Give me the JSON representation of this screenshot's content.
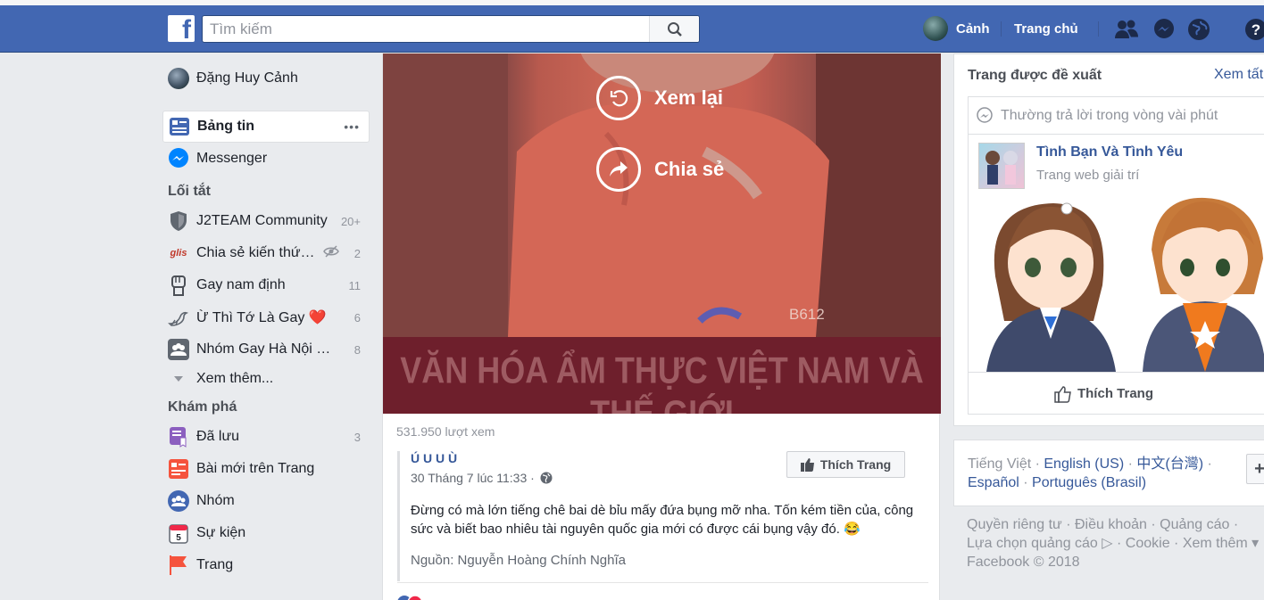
{
  "header": {
    "logo": "f",
    "search_placeholder": "Tìm kiếm",
    "user_name": "Cảnh",
    "home": "Trang chủ",
    "help": "?"
  },
  "nav": {
    "profile": "Đặng Huy Cảnh",
    "news_feed": "Bảng tin",
    "news_feed_more": "•••",
    "messenger": "Messenger",
    "shortcuts_title": "Lối tắt",
    "shortcuts": [
      {
        "label": "J2TEAM Community",
        "count": "20+"
      },
      {
        "label": "Chia sẻ kiến thứ…",
        "count": "2"
      },
      {
        "label": "Gay nam định",
        "count": "11"
      },
      {
        "label": "Ừ Thì Tớ Là Gay ❤️",
        "count": "6"
      },
      {
        "label": "Nhóm Gay Hà Nội …",
        "count": "8"
      }
    ],
    "shortcuts_more": "Xem thêm...",
    "explore_title": "Khám phá",
    "explore": [
      {
        "label": "Đã lưu",
        "count": "3"
      },
      {
        "label": "Bài mới trên Trang",
        "count": ""
      },
      {
        "label": "Nhóm",
        "count": ""
      },
      {
        "label": "Sự kiện",
        "count": ""
      },
      {
        "label": "Trang",
        "count": ""
      }
    ],
    "glis_icon_text": "glis"
  },
  "post": {
    "replay": "Xem lại",
    "share": "Chia sẻ",
    "banner": "VĂN HÓA ẨM THỰC VIỆT NAM VÀ THẾ GIỚI",
    "watermark": "B612",
    "views": "531.950 lượt xem",
    "page_name": "Ú U U Ù",
    "timestamp": "30 Tháng 7 lúc 11:33 ·",
    "like_page": "Thích Trang",
    "text": "Đừng có mà lớn tiếng chê bai dè bỉu mấy đứa bụng mỡ nha. Tốn kém tiền của, công sức và biết bao nhiêu tài nguyên quốc gia mới có được cái bụng vậy đó. 😂",
    "source": "Nguồn: Nguyễn Hoàng Chính Nghĩa"
  },
  "suggested": {
    "title": "Trang được đề xuất",
    "see_all": "Xem tất",
    "respond": "Thường trả lời trong vòng vài phút",
    "page_name": "Tình Bạn Và Tình Yêu",
    "category": "Trang web giải trí",
    "like": "Thích Trang"
  },
  "languages": {
    "current": "Tiếng Việt",
    "sep": " · ",
    "options": [
      "English (US)",
      "中文(台灣)",
      "Español",
      "Português (Brasil)"
    ],
    "add": "+"
  },
  "footer": {
    "line1": "Quyền riêng tư · Điều khoản · Quảng cáo ·",
    "line2": "Lựa chọn quảng cáo ▷ · Cookie · Xem thêm ▾",
    "line3": "Facebook © 2018"
  },
  "colors": {
    "brand": "#4267b2",
    "link": "#365899",
    "bg": "#e9ebee"
  }
}
